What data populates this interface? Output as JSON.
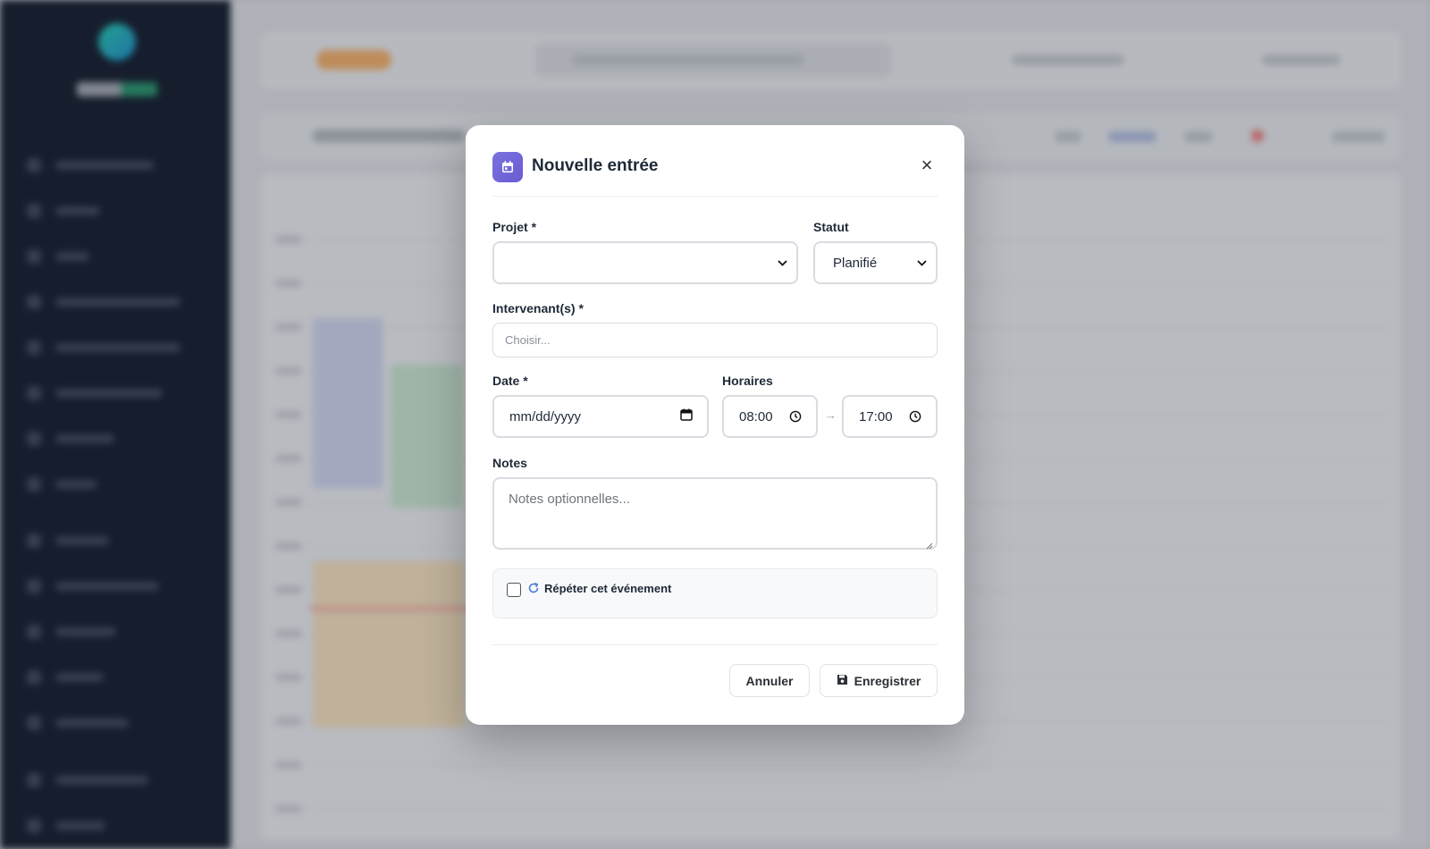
{
  "modal": {
    "title": "Nouvelle entrée",
    "icon": "calendar-icon",
    "accent_color": "#6f63d8",
    "close_label": "×",
    "fields": {
      "projet": {
        "label": "Projet *",
        "value": ""
      },
      "statut": {
        "label": "Statut",
        "value": "Planifié"
      },
      "intervenants": {
        "label": "Intervenant(s) *",
        "placeholder": "Choisir..."
      },
      "date": {
        "label": "Date *",
        "value": "mm/dd/yyyy"
      },
      "horaires": {
        "label": "Horaires",
        "start": "08:00",
        "end": "17:00",
        "separator": "→"
      },
      "notes": {
        "label": "Notes",
        "placeholder": "Notes optionnelles..."
      }
    },
    "repeat": {
      "label": "Répéter cet événement",
      "checked": false
    },
    "buttons": {
      "cancel": "Annuler",
      "save": "Enregistrer"
    }
  }
}
